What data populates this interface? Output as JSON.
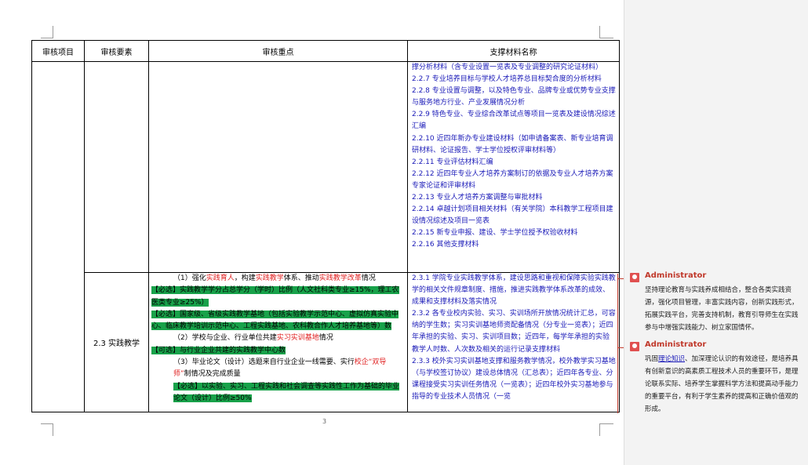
{
  "table": {
    "headers": [
      "审核项目",
      "审核要素",
      "审核重点",
      "支撑材料名称"
    ],
    "row1_materials": [
      "撑分析材料（含专业设置一览表及专业调整的研究论证材料）",
      "2.2.7 专业培养目标与学校人才培养总目标契合度的分析材料",
      "2.2.8 专业设置与调整，以及特色专业、品牌专业或优势专业支撑与服务地方行业、产业发展情况分析",
      "2.2.9 特色专业、专业综合改革试点等项目一览表及建设情况综述汇编",
      "2.2.10 近四年新办专业建设材料（如申请备案表、新专业培育调研材料、论证报告、学士学位授权评审材料等）",
      "2.2.11 专业评估材料汇编",
      "2.2.12 近四年专业人才培养方案制订的依据及专业人才培养方案专家论证和评审材料",
      "2.2.13 专业人才培养方案调整与审批材料",
      "2.2.14 卓越计划项目相关材料（有关学院）本科教学工程项目建设情况综述及项目一览表",
      "2.2.15 新专业申报、建设、学士学位授予权验收材料",
      "2.2.16 其他支撑材料"
    ],
    "row2_element": "2.3 实践教学",
    "row2_points": {
      "p1_a": "（1）强化",
      "p1_red1": "实践育人",
      "p1_b": "，构建",
      "p1_red2": "实践教学",
      "p1_c": "体系、推动",
      "p1_red3": "实践教学改革",
      "p1_d": "情况",
      "req1": "【必选】实践教学学分占总学分（学时）比例（人文社科类专业≥15%，理工农医类专业≥25%）",
      "req2": "【必选】国家级、省级实践教学基地（包括实验教学示范中心、虚拟仿真实验中心、临床教学培训示范中心、工程实践基地、农科教合作人才培养基地等）数",
      "p2_a": "（2）学校与企业、行业单位共建",
      "p2_red": "实习实训基地",
      "p2_b": "情况",
      "opt1": "【可选】与行业企业共建的实践教学中心数",
      "p3_a": "（3）毕业论文（设计）选题来自行业企业一线需要、实行",
      "p3_red": "校企“双导师”",
      "p3_b": "制情况及完成质量",
      "req3": "【必选】以实验、实习、工程实践和社会调查等实践性工作为基础的毕业论文（设计）比例≥50%"
    },
    "row2_materials": [
      "2.3.1 学院专业实践教学体系，建设思路和重视和保障实验实践教学的相关文件规章制度、措施，推进实践教学体系改革的成效、成果和支撑材料及落实情况",
      "2.3.2 各专业校内实验、实习、实训场所开放情况统计汇总，可容纳的学生数；实习实训基地师资配备情况（分专业一览表）；近四年承担的实验、实习、实训项目数；近四年，每学年承担的实验教学人时数、人次数及相关的运行记录支撑材料",
      "2.3.3 校外实习实训基地支撑和服务教学情况，校外教学实习基地（与学校签订协议）建设总体情况（汇总表）；近四年各专业、分课程接受实习实训任务情况（一览表）；近四年校外实习基地参与指导的专业技术人员情况（一览"
    ]
  },
  "page_number": "3",
  "comments": [
    {
      "author": "Administrator",
      "text_a": "坚持理论教育与实践养成相结合，整合各类实践资源，强化项目管理，丰富实践内容，创新实践形式，拓展实践平台，完善支持机制，教育引导师生在实践参与中增强实践能力、树立家国情怀。"
    },
    {
      "author": "Administrator",
      "text_a": "巩固",
      "link": "理论知识",
      "text_b": "、加深理论认识的有效途径，是培养具有创新意识的高素质工程技术人员的重要环节，是理论联系实际、培养学生掌握科学方法和提高动手能力的重要平台，有利于学生素养的提高和正确价值观的形成。"
    }
  ]
}
